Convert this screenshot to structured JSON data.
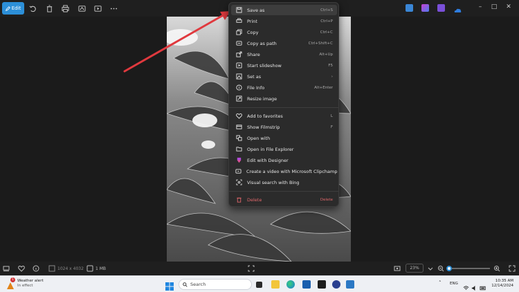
{
  "toolbar": {
    "edit_label": "Edit",
    "icons": [
      "rotate-icon",
      "delete-icon",
      "print-icon",
      "edit-image-icon",
      "slideshow-icon",
      "more-icon"
    ]
  },
  "window_controls": {
    "minimize": "–",
    "maximize": "□",
    "close": "✕"
  },
  "context_menu": {
    "items": [
      {
        "label": "Save as",
        "shortcut": "Ctrl+S",
        "icon": "save-icon"
      },
      {
        "label": "Print",
        "shortcut": "Ctrl+P",
        "icon": "print-icon"
      },
      {
        "label": "Copy",
        "shortcut": "Ctrl+C",
        "icon": "copy-icon"
      },
      {
        "label": "Copy as path",
        "shortcut": "Ctrl+Shift+C",
        "icon": "copy-path-icon"
      },
      {
        "label": "Share",
        "shortcut": "Alt+Up",
        "icon": "share-icon"
      },
      {
        "label": "Start slideshow",
        "shortcut": "F5",
        "icon": "slideshow-icon"
      },
      {
        "label": "Set as",
        "shortcut": "›",
        "icon": "set-as-icon"
      },
      {
        "label": "File Info",
        "shortcut": "Alt+Enter",
        "icon": "info-icon"
      },
      {
        "label": "Resize image",
        "shortcut": "",
        "icon": "resize-icon"
      },
      {
        "label": "Add to favorites",
        "shortcut": "L",
        "icon": "heart-icon"
      },
      {
        "label": "Show Filmstrip",
        "shortcut": "F",
        "icon": "filmstrip-icon"
      },
      {
        "label": "Open with",
        "shortcut": "",
        "icon": "open-with-icon"
      },
      {
        "label": "Open in File Explorer",
        "shortcut": "",
        "icon": "folder-icon"
      },
      {
        "label": "Edit with Designer",
        "shortcut": "",
        "icon": "designer-icon"
      },
      {
        "label": "Create a video with Microsoft Clipchamp",
        "shortcut": "",
        "icon": "clipchamp-icon"
      },
      {
        "label": "Visual search with Bing",
        "shortcut": "",
        "icon": "visual-search-icon"
      },
      {
        "label": "Delete",
        "shortcut": "Delete",
        "icon": "delete-icon"
      }
    ]
  },
  "status": {
    "dimensions": "1024 x 4032",
    "file_size": "1 MB",
    "zoom": "23%",
    "zoom_fraction": 0.05
  },
  "taskbar": {
    "weather_title": "Weather alert",
    "weather_sub": "In effect",
    "weather_badge": "1",
    "search_placeholder": "Search",
    "language": "ENG",
    "time": "10:35 AM",
    "date": "12/14/2024"
  },
  "colors": {
    "accent": "#2c8fd8",
    "danger": "#e0676b",
    "arrow": "#e0393e"
  }
}
